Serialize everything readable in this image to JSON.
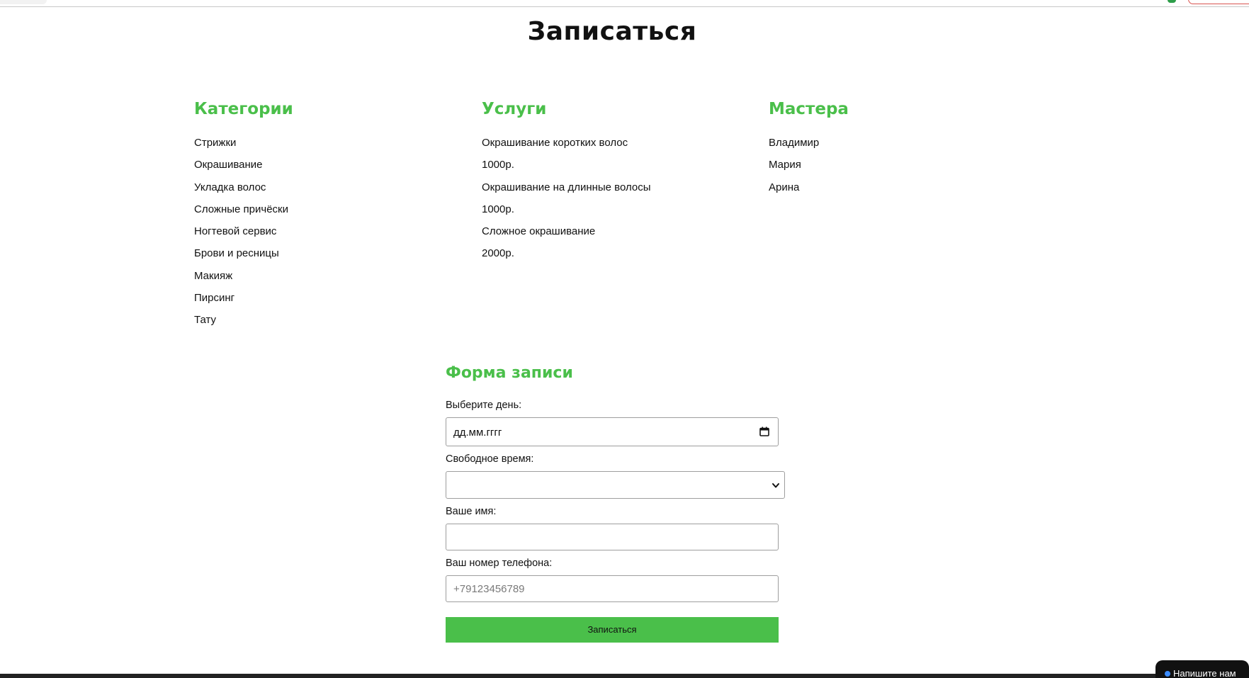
{
  "page": {
    "title": "Записаться"
  },
  "columns": {
    "categories": {
      "heading": "Категории",
      "items": [
        "Стрижки",
        "Окрашивание",
        "Укладка волос",
        "Сложные причёски",
        "Ногтевой сервис",
        "Брови и ресницы",
        "Макияж",
        "Пирсинг",
        "Тату"
      ]
    },
    "services": {
      "heading": "Услуги",
      "items": [
        "Окрашивание коротких волос",
        "1000р.",
        "Окрашивание на длинные волосы",
        "1000р.",
        "Сложное окрашивание",
        "2000р."
      ]
    },
    "masters": {
      "heading": "Мастера",
      "items": [
        "Владимир",
        "Мария",
        "Арина"
      ]
    }
  },
  "form": {
    "heading": "Форма записи",
    "day_label": "Выберите день:",
    "day_value": "дд.мм.гггг",
    "time_label": "Свободное время:",
    "time_value": "",
    "name_label": "Ваше имя:",
    "name_value": "",
    "phone_label": "Ваш номер телефона:",
    "phone_placeholder": "+79123456789",
    "submit_label": "Записаться"
  },
  "chat": {
    "label": "Напишите нам"
  },
  "colors": {
    "accent": "#4abf4a",
    "text": "#111111"
  },
  "icons": {
    "date_picker": "calendar-icon",
    "select": "chevron-down-icon",
    "chat": "chat-dot-icon"
  }
}
